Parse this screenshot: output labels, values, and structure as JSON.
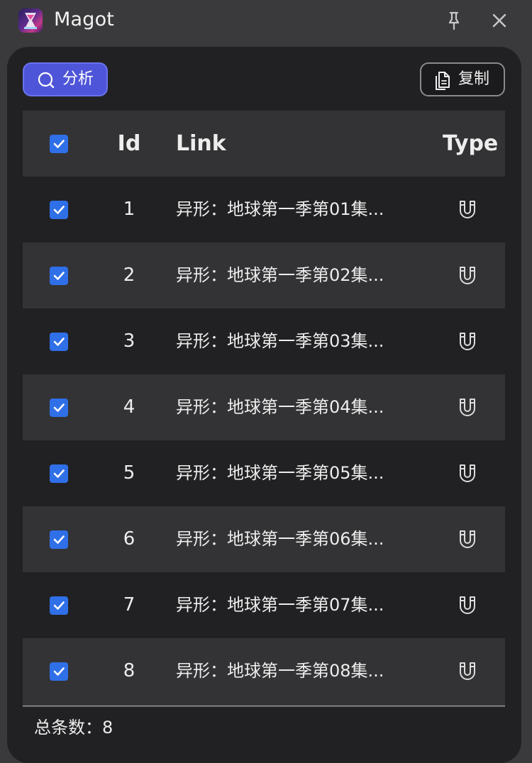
{
  "window": {
    "title": "Magot"
  },
  "toolbar": {
    "analyze_label": "分析",
    "copy_label": "复制"
  },
  "table": {
    "columns": {
      "id": "Id",
      "link": "Link",
      "type": "Type"
    },
    "rows": [
      {
        "id": "1",
        "link": "异形：地球第一季第01集...",
        "type_icon": "magnet-icon",
        "checked": true
      },
      {
        "id": "2",
        "link": "异形：地球第一季第02集...",
        "type_icon": "magnet-icon",
        "checked": true
      },
      {
        "id": "3",
        "link": "异形：地球第一季第03集...",
        "type_icon": "magnet-icon",
        "checked": true
      },
      {
        "id": "4",
        "link": "异形：地球第一季第04集...",
        "type_icon": "magnet-icon",
        "checked": true
      },
      {
        "id": "5",
        "link": "异形：地球第一季第05集...",
        "type_icon": "magnet-icon",
        "checked": true
      },
      {
        "id": "6",
        "link": "异形：地球第一季第06集...",
        "type_icon": "magnet-icon",
        "checked": true
      },
      {
        "id": "7",
        "link": "异形：地球第一季第07集...",
        "type_icon": "magnet-icon",
        "checked": true
      },
      {
        "id": "8",
        "link": "异形：地球第一季第08集...",
        "type_icon": "magnet-icon",
        "checked": true
      }
    ]
  },
  "footer": {
    "total_label": "总条数：8"
  },
  "colors": {
    "accent": "#4f55d8",
    "checkbox": "#2f6fe8",
    "panel_bg": "#212123",
    "row_alt_bg": "#333335",
    "window_bg": "#3a3a3c"
  }
}
